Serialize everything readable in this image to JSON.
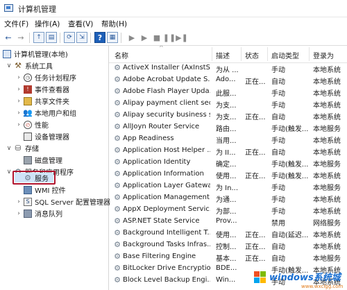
{
  "window": {
    "title": "计算机管理"
  },
  "menu": [
    "文件(F)",
    "操作(A)",
    "查看(V)",
    "帮助(H)"
  ],
  "toolbar": {
    "back": "←",
    "forward": "→",
    "up": "↑",
    "show_hide": "▤",
    "refresh": "⟳",
    "export": "⇲",
    "help": "?",
    "console": "▦",
    "play": "▶",
    "play2": "▶",
    "stop": "■",
    "pause": "❚❚",
    "restart": "▶❚"
  },
  "tree": {
    "root": "计算机管理(本地)",
    "system_tools": "系统工具",
    "task_scheduler": "任务计划程序",
    "event_viewer": "事件查看器",
    "shared_folders": "共享文件夹",
    "local_users": "本地用户和组",
    "performance": "性能",
    "device_manager": "设备管理器",
    "storage": "存储",
    "disk_management": "磁盘管理",
    "services_apps": "服务和应用程序",
    "services": "服务",
    "wmi": "WMI 控件",
    "sql": "SQL Server 配置管理器",
    "queue": "消息队列"
  },
  "columns": {
    "name": "名称",
    "desc": "描述",
    "status": "状态",
    "startup": "启动类型",
    "logon": "登录为"
  },
  "services": [
    {
      "name": "ActiveX Installer (AxInstSV)",
      "desc": "为从 ...",
      "status": "",
      "startup": "手动",
      "logon": "本地系统"
    },
    {
      "name": "Adobe Acrobat Update S...",
      "desc": "Ado...",
      "status": "正在...",
      "startup": "自动",
      "logon": "本地系统"
    },
    {
      "name": "Adobe Flash Player Upda...",
      "desc": "此服...",
      "status": "",
      "startup": "手动",
      "logon": "本地系统"
    },
    {
      "name": "Alipay payment client sec...",
      "desc": "为支...",
      "status": "",
      "startup": "手动",
      "logon": "本地系统"
    },
    {
      "name": "Alipay security business s...",
      "desc": "为支...",
      "status": "正在...",
      "startup": "自动",
      "logon": "本地系统"
    },
    {
      "name": "AllJoyn Router Service",
      "desc": "路由...",
      "status": "",
      "startup": "手动(触发...",
      "logon": "本地服务"
    },
    {
      "name": "App Readiness",
      "desc": "当用...",
      "status": "",
      "startup": "手动",
      "logon": "本地系统"
    },
    {
      "name": "Application Host Helper ...",
      "desc": "为 II...",
      "status": "正在...",
      "startup": "自动",
      "logon": "本地系统"
    },
    {
      "name": "Application Identity",
      "desc": "确定...",
      "status": "",
      "startup": "手动(触发...",
      "logon": "本地服务"
    },
    {
      "name": "Application Information",
      "desc": "使用...",
      "status": "正在...",
      "startup": "手动(触发...",
      "logon": "本地系统"
    },
    {
      "name": "Application Layer Gatewa...",
      "desc": "为 In...",
      "status": "",
      "startup": "手动",
      "logon": "本地服务"
    },
    {
      "name": "Application Management",
      "desc": "为通...",
      "status": "",
      "startup": "手动",
      "logon": "本地系统"
    },
    {
      "name": "AppX Deployment Servic...",
      "desc": "为部...",
      "status": "",
      "startup": "手动",
      "logon": "本地系统"
    },
    {
      "name": "ASP.NET State Service",
      "desc": "Prov...",
      "status": "",
      "startup": "禁用",
      "logon": "网络服务"
    },
    {
      "name": "Background Intelligent T...",
      "desc": "使用...",
      "status": "正在...",
      "startup": "自动(延迟...",
      "logon": "本地系统"
    },
    {
      "name": "Background Tasks Infras...",
      "desc": "控制...",
      "status": "正在...",
      "startup": "自动",
      "logon": "本地系统"
    },
    {
      "name": "Base Filtering Engine",
      "desc": "基本...",
      "status": "正在...",
      "startup": "自动",
      "logon": "本地服务"
    },
    {
      "name": "BitLocker Drive Encryptio...",
      "desc": "BDE...",
      "status": "",
      "startup": "手动(触发...",
      "logon": "本地系统"
    },
    {
      "name": "Block Level Backup Engi...",
      "desc": "Win...",
      "status": "",
      "startup": "手动",
      "logon": "本地系统"
    }
  ],
  "watermark": {
    "brand": "windows系统城",
    "sub": "www.wxclgg.com"
  }
}
